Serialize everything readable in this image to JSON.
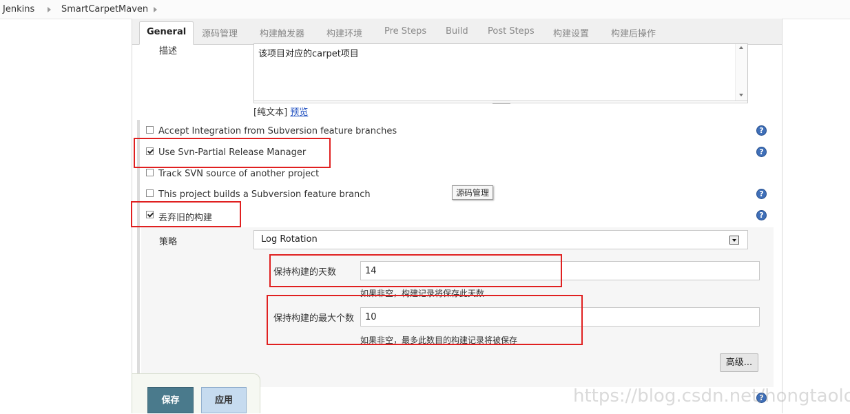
{
  "breadcrumb": {
    "items": [
      "Jenkins",
      "SmartCarpetMaven"
    ]
  },
  "tabs": [
    "General",
    "源码管理",
    "构建触发器",
    "构建环境",
    "Pre Steps",
    "Build",
    "Post Steps",
    "构建设置",
    "构建后操作"
  ],
  "description": {
    "label": "描述",
    "value": "该项目对应的carpet项目",
    "plain_text": "[纯文本]",
    "preview_link": "预览"
  },
  "options": [
    {
      "label": "Accept Integration from Subversion feature branches",
      "checked": false
    },
    {
      "label": "Use Svn-Partial Release Manager",
      "checked": true
    },
    {
      "label": "Track SVN source of another project",
      "checked": false
    },
    {
      "label": "This project builds a Subversion feature branch",
      "checked": false
    },
    {
      "label": "丢弃旧的构建",
      "checked": true
    }
  ],
  "help_icon": "?",
  "tooltip": "源码管理",
  "strategy": {
    "label": "策略",
    "selected": "Log Rotation"
  },
  "days_to_keep": {
    "label": "保持构建的天数",
    "value": "14",
    "hint": "如果非空，构建记录将保存此天数"
  },
  "max_builds": {
    "label": "保持构建的最大个数",
    "value": "10",
    "hint": "如果非空，最多此数目的构建记录将被保存"
  },
  "advanced_button": "高级...",
  "footer": {
    "save": "保存",
    "apply": "应用"
  },
  "watermark": "https://blog.csdn.net/hongtaolong",
  "colors": {
    "highlight_box": "#e02020",
    "save_button": "#4a7a8c",
    "apply_button": "#c6dbef",
    "help_icon": "#3f6fb8"
  }
}
